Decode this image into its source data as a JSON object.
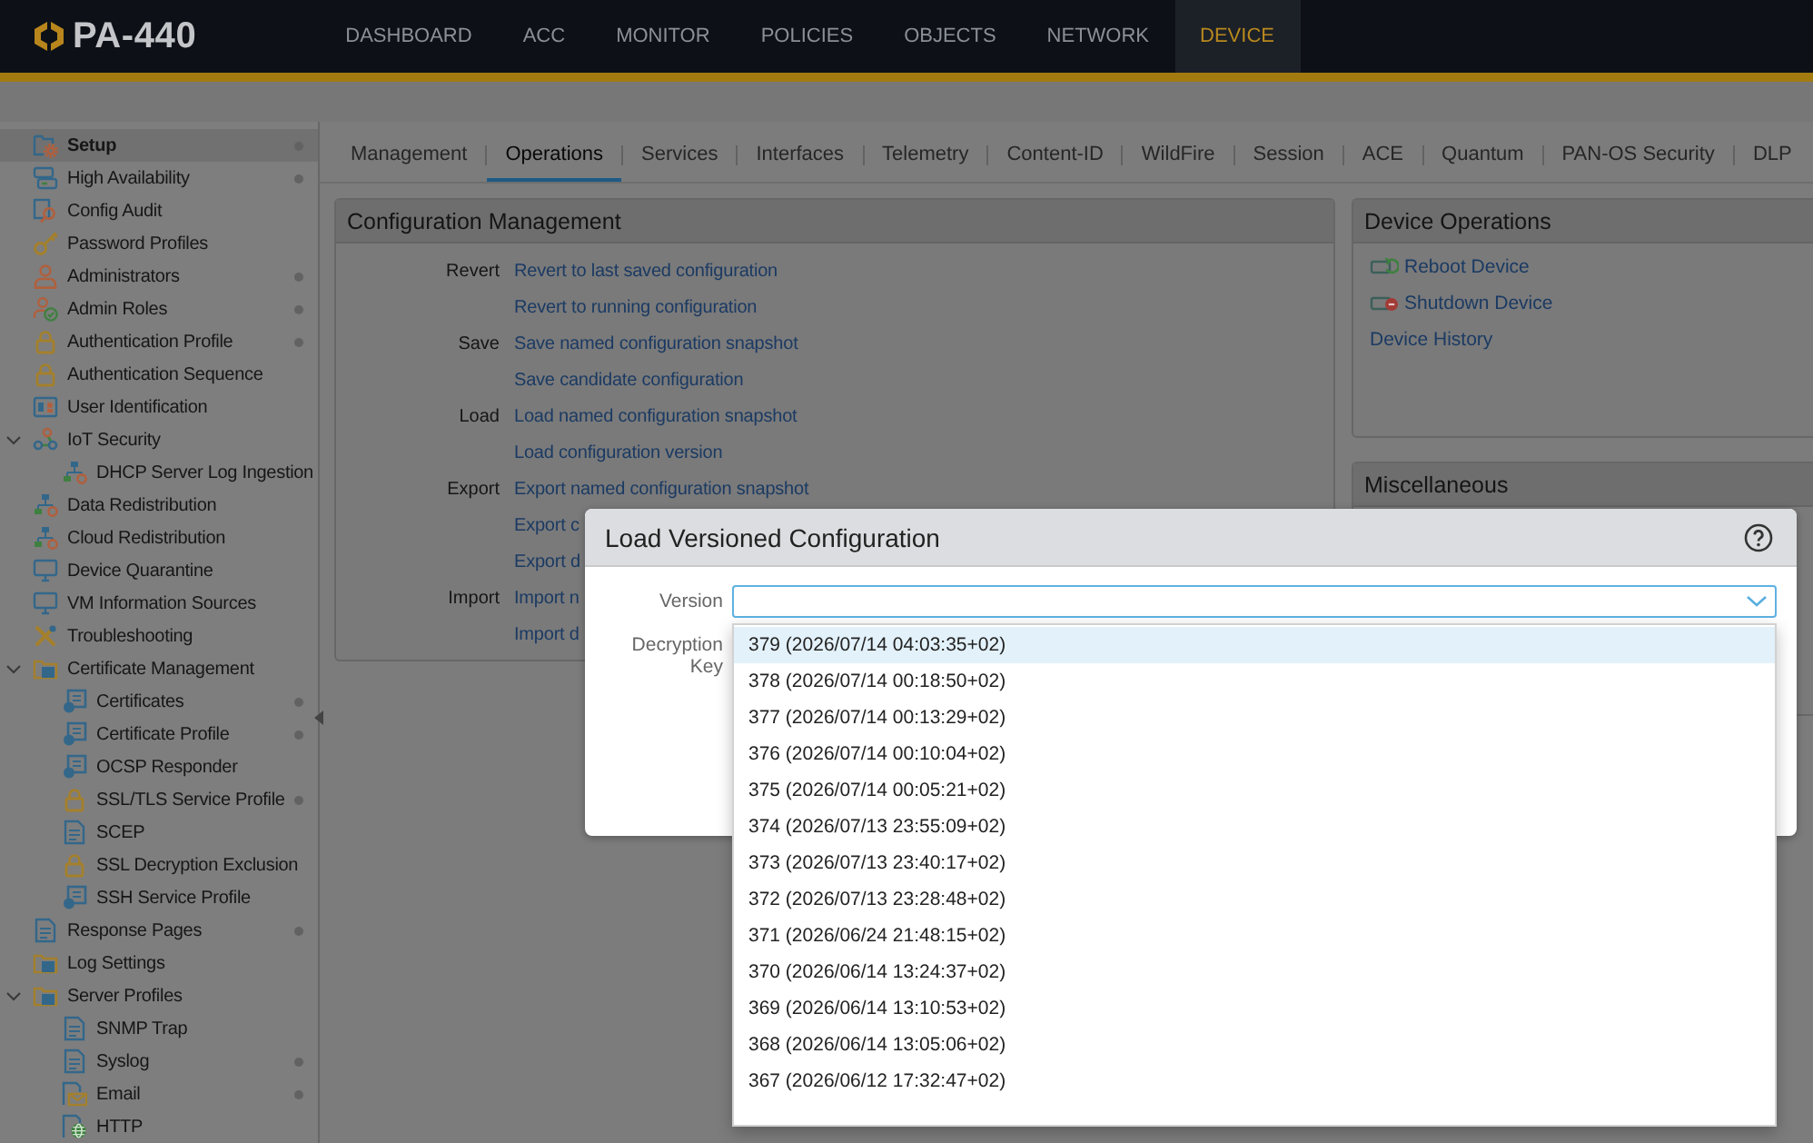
{
  "header": {
    "device_name": "PA-440",
    "nav": [
      {
        "label": "DASHBOARD",
        "selected": false
      },
      {
        "label": "ACC",
        "selected": false
      },
      {
        "label": "MONITOR",
        "selected": false
      },
      {
        "label": "POLICIES",
        "selected": false
      },
      {
        "label": "OBJECTS",
        "selected": false
      },
      {
        "label": "NETWORK",
        "selected": false
      },
      {
        "label": "DEVICE",
        "selected": true
      }
    ]
  },
  "sidebar": {
    "items": [
      {
        "label": "Setup",
        "selected": true,
        "indicator": true
      },
      {
        "label": "High Availability",
        "selected": false,
        "indicator": true
      },
      {
        "label": "Config Audit",
        "selected": false,
        "indicator": false
      },
      {
        "label": "Password Profiles",
        "selected": false,
        "indicator": false
      },
      {
        "label": "Administrators",
        "selected": false,
        "indicator": true
      },
      {
        "label": "Admin Roles",
        "selected": false,
        "indicator": true
      },
      {
        "label": "Authentication Profile",
        "selected": false,
        "indicator": true
      },
      {
        "label": "Authentication Sequence",
        "selected": false,
        "indicator": false
      },
      {
        "label": "User Identification",
        "selected": false,
        "indicator": false
      },
      {
        "label": "IoT Security",
        "selected": false,
        "indicator": false,
        "expanded": true,
        "children": [
          {
            "label": "DHCP Server Log Ingestion",
            "selected": false,
            "indicator": false
          }
        ]
      },
      {
        "label": "Data Redistribution",
        "selected": false,
        "indicator": false
      },
      {
        "label": "Cloud Redistribution",
        "selected": false,
        "indicator": false
      },
      {
        "label": "Device Quarantine",
        "selected": false,
        "indicator": false
      },
      {
        "label": "VM Information Sources",
        "selected": false,
        "indicator": false
      },
      {
        "label": "Troubleshooting",
        "selected": false,
        "indicator": false
      },
      {
        "label": "Certificate Management",
        "selected": false,
        "indicator": false,
        "expanded": true,
        "children": [
          {
            "label": "Certificates",
            "selected": false,
            "indicator": true
          },
          {
            "label": "Certificate Profile",
            "selected": false,
            "indicator": true
          },
          {
            "label": "OCSP Responder",
            "selected": false,
            "indicator": false
          },
          {
            "label": "SSL/TLS Service Profile",
            "selected": false,
            "indicator": true
          },
          {
            "label": "SCEP",
            "selected": false,
            "indicator": false
          },
          {
            "label": "SSL Decryption Exclusion",
            "selected": false,
            "indicator": false
          },
          {
            "label": "SSH Service Profile",
            "selected": false,
            "indicator": false
          }
        ]
      },
      {
        "label": "Response Pages",
        "selected": false,
        "indicator": true
      },
      {
        "label": "Log Settings",
        "selected": false,
        "indicator": false
      },
      {
        "label": "Server Profiles",
        "selected": false,
        "indicator": false,
        "expanded": true,
        "children": [
          {
            "label": "SNMP Trap",
            "selected": false,
            "indicator": false
          },
          {
            "label": "Syslog",
            "selected": false,
            "indicator": true
          },
          {
            "label": "Email",
            "selected": false,
            "indicator": true
          },
          {
            "label": "HTTP",
            "selected": false,
            "indicator": false
          }
        ]
      }
    ]
  },
  "tabs": [
    {
      "label": "Management",
      "selected": false
    },
    {
      "label": "Operations",
      "selected": true
    },
    {
      "label": "Services",
      "selected": false
    },
    {
      "label": "Interfaces",
      "selected": false
    },
    {
      "label": "Telemetry",
      "selected": false
    },
    {
      "label": "Content-ID",
      "selected": false
    },
    {
      "label": "WildFire",
      "selected": false
    },
    {
      "label": "Session",
      "selected": false
    },
    {
      "label": "ACE",
      "selected": false
    },
    {
      "label": "Quantum",
      "selected": false
    },
    {
      "label": "PAN-OS Security",
      "selected": false
    },
    {
      "label": "DLP",
      "selected": false
    }
  ],
  "config_management": {
    "title": "Configuration Management",
    "rows": [
      {
        "label": "Revert",
        "link": "Revert to last saved configuration"
      },
      {
        "link": "Revert to running configuration"
      },
      {
        "label": "Save",
        "link": "Save named configuration snapshot"
      },
      {
        "link": "Save candidate configuration"
      },
      {
        "label": "Load",
        "link": "Load named configuration snapshot"
      },
      {
        "link": "Load configuration version"
      },
      {
        "label": "Export",
        "link": "Export named configuration snapshot"
      },
      {
        "link": "Export c"
      },
      {
        "link": "Export d"
      },
      {
        "label": "Import",
        "link": "Import n"
      },
      {
        "link": "Import d"
      }
    ]
  },
  "device_operations": {
    "title": "Device Operations",
    "items": [
      {
        "kind": "reboot",
        "label": "Reboot Device"
      },
      {
        "kind": "shutdown",
        "label": "Shutdown Device"
      },
      {
        "kind": "plain",
        "label": "Device History"
      }
    ]
  },
  "miscellaneous": {
    "title": "Miscellaneous"
  },
  "dialog": {
    "title": "Load Versioned Configuration",
    "version": {
      "label": "Version",
      "expanded": true,
      "options": [
        {
          "label": "379 (2026/07/14 04:03:35+02)",
          "selected": true
        },
        {
          "label": "378 (2026/07/14 00:18:50+02)",
          "selected": false
        },
        {
          "label": "377 (2026/07/14 00:13:29+02)",
          "selected": false
        },
        {
          "label": "376 (2026/07/14 00:10:04+02)",
          "selected": false
        },
        {
          "label": "375 (2026/07/14 00:05:21+02)",
          "selected": false
        },
        {
          "label": "374 (2026/07/13 23:55:09+02)",
          "selected": false
        },
        {
          "label": "373 (2026/07/13 23:40:17+02)",
          "selected": false
        },
        {
          "label": "372 (2026/07/13 23:28:48+02)",
          "selected": false
        },
        {
          "label": "371 (2026/06/24 21:48:15+02)",
          "selected": false
        },
        {
          "label": "370 (2026/06/14 13:24:37+02)",
          "selected": false
        },
        {
          "label": "369 (2026/06/14 13:10:53+02)",
          "selected": false
        },
        {
          "label": "368 (2026/06/14 13:05:06+02)",
          "selected": false
        },
        {
          "label": "367 (2026/06/12 17:32:47+02)",
          "selected": false
        }
      ]
    },
    "decryption_key": {
      "label": "Decryption Key"
    }
  }
}
